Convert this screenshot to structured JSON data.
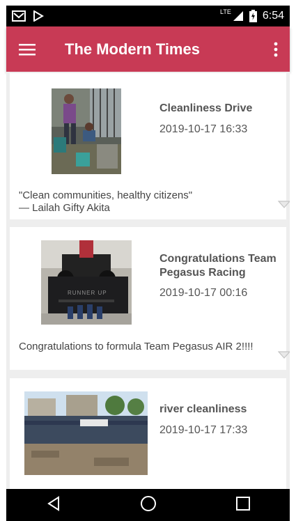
{
  "status_bar": {
    "time": "6:54",
    "network": "LTE"
  },
  "app_bar": {
    "title": "The Modern Times"
  },
  "articles": [
    {
      "title": "Cleanliness Drive",
      "date": "2019-10-17 16:33",
      "description": "\"Clean communities, healthy citizens\"\n— Lailah Gifty Akita"
    },
    {
      "title": "Congratulations Team Pegasus Racing",
      "date": "2019-10-17 00:16",
      "description": "Congratulations to formula Team Pegasus AIR 2!!!!",
      "image_text": "RUNNER UP"
    },
    {
      "title": "river cleanliness",
      "date": "2019-10-17 17:33"
    }
  ],
  "icons": {
    "menu": "menu-icon",
    "overflow": "more-vert-icon",
    "expand": "expand-triangle-icon",
    "back": "back-icon",
    "home": "home-icon",
    "recents": "recents-icon"
  },
  "colors": {
    "app_bar": "#c83a55",
    "status_bar": "#000000",
    "background": "#eeeeee"
  }
}
